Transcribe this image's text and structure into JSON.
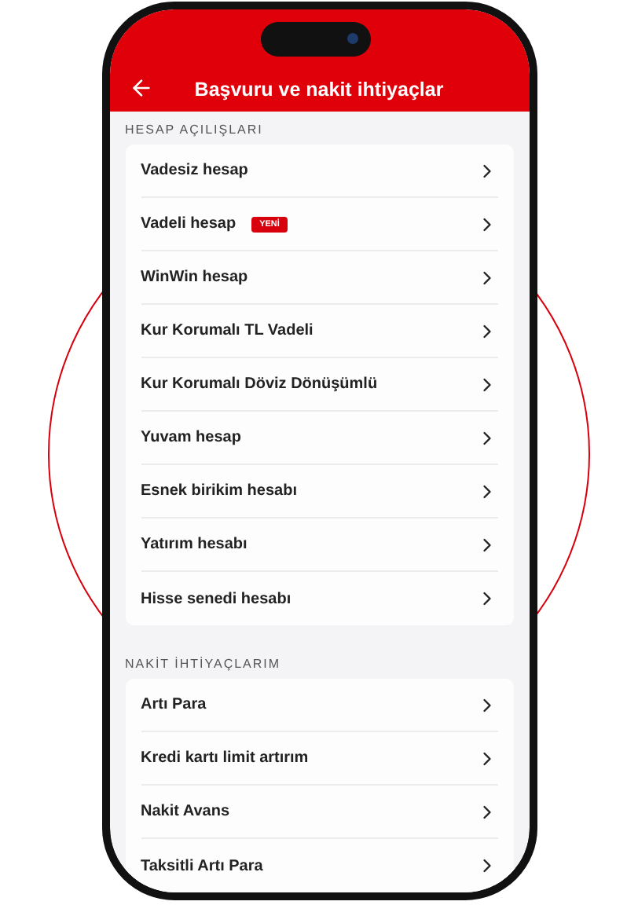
{
  "header": {
    "title": "Başvuru ve nakit ihtiyaçlar"
  },
  "sections": [
    {
      "title": "HESAP AÇILIŞLARI",
      "items": [
        {
          "label": "Vadesiz hesap"
        },
        {
          "label": "Vadeli hesap",
          "badge": "YENİ"
        },
        {
          "label": "WinWin hesap"
        },
        {
          "label": "Kur Korumalı TL Vadeli"
        },
        {
          "label": "Kur Korumalı Döviz Dönüşümlü"
        },
        {
          "label": "Yuvam hesap"
        },
        {
          "label": "Esnek birikim hesabı"
        },
        {
          "label": "Yatırım hesabı"
        },
        {
          "label": "Hisse senedi hesabı"
        }
      ]
    },
    {
      "title": "NAKİT İHTİYAÇLARIM",
      "items": [
        {
          "label": "Artı Para"
        },
        {
          "label": "Kredi kartı limit artırım"
        },
        {
          "label": "Nakit Avans"
        },
        {
          "label": "Taksitli Artı Para"
        }
      ]
    }
  ]
}
